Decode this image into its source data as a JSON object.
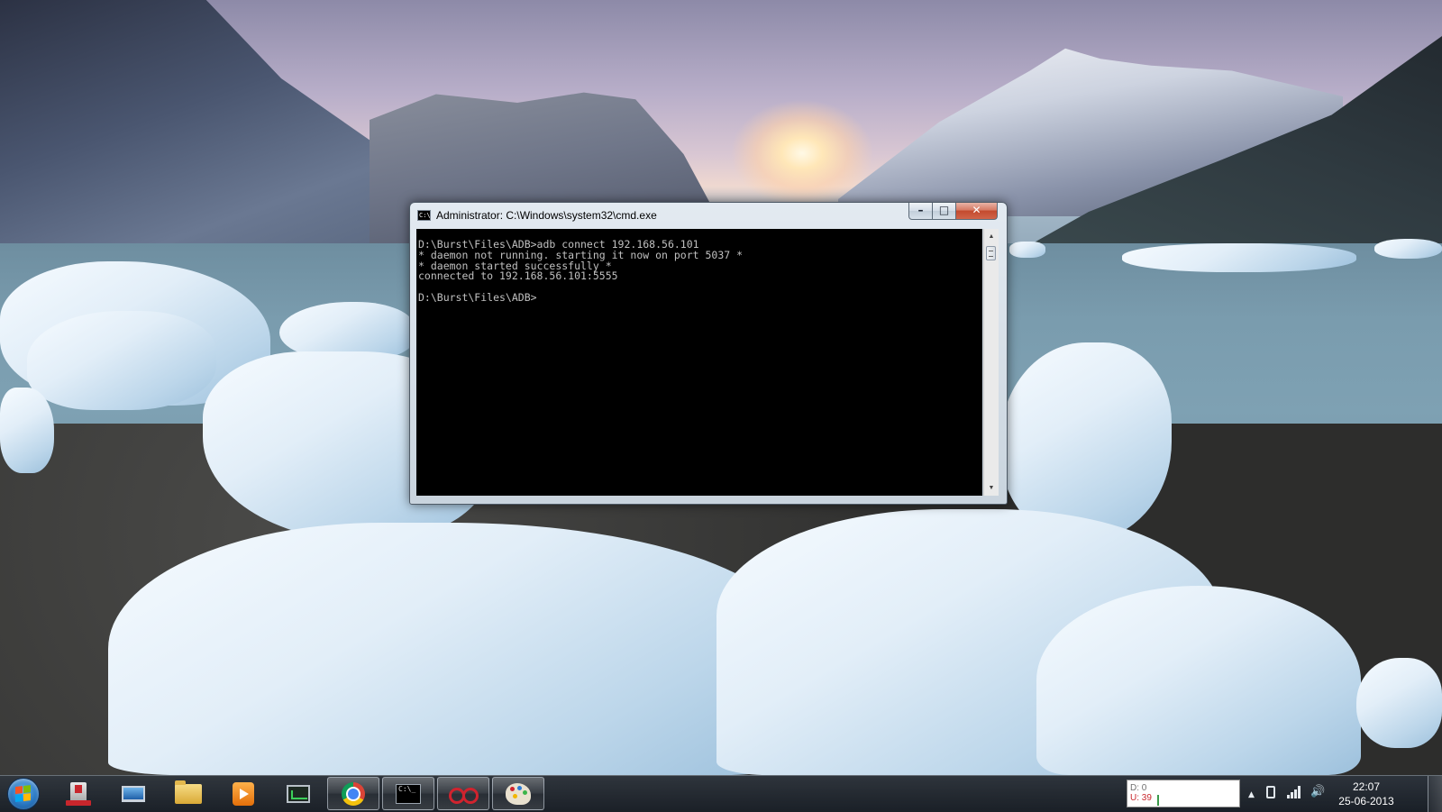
{
  "cmd_window": {
    "title": "Administrator: C:\\Windows\\system32\\cmd.exe",
    "icon_text": "C:\\",
    "controls": {
      "minimize": "–",
      "maximize": "□",
      "close": "✕"
    },
    "console_lines": [
      "D:\\Burst\\Files\\ADB>adb connect 192.168.56.101",
      "* daemon not running. starting it now on port 5037 *",
      "* daemon started successfully *",
      "connected to 192.168.56.101:5555",
      "",
      "D:\\Burst\\Files\\ADB>"
    ],
    "scroll_up": "▲",
    "scroll_down": "▼"
  },
  "taskbar": {
    "pinned": [
      {
        "name": "usb-tool-icon",
        "active": false
      },
      {
        "name": "computer-icon",
        "active": false
      },
      {
        "name": "folder-icon",
        "active": false
      },
      {
        "name": "media-player-icon",
        "active": false
      },
      {
        "name": "task-manager-icon",
        "active": false
      },
      {
        "name": "chrome-icon",
        "active": true
      },
      {
        "name": "cmd-icon",
        "active": true
      },
      {
        "name": "loop-app-icon",
        "active": true
      },
      {
        "name": "paint-icon",
        "active": true
      }
    ],
    "cmd_icon_text": "C:\\_"
  },
  "tray": {
    "net_down": "D: 0",
    "net_up": "U: 39",
    "arrow": "▲",
    "volume": "🔊"
  },
  "clock": {
    "time": "22:07",
    "date": "25-06-2013"
  }
}
